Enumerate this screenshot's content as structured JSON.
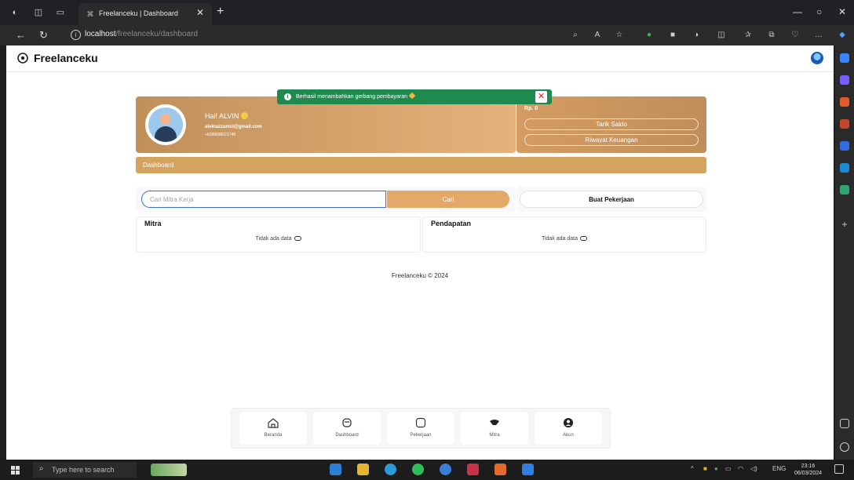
{
  "browser": {
    "tab_title": "Freelanceku | Dashboard",
    "url_host": "localhost",
    "url_path": "/freelanceku/dashboard"
  },
  "header": {
    "brand": "Freelanceku"
  },
  "toast": {
    "message": "Berhasil menambahkan gerbang pembayaran"
  },
  "profile": {
    "greeting": "Hai! ALVIN",
    "email": "alvinazzamul@gmail.com",
    "phone": "+6289686021748"
  },
  "wallet": {
    "balance": "Rp. 0",
    "withdraw_label": "Tarik Saldo",
    "history_label": "Riwayat Keuangan"
  },
  "dashboard_bar": {
    "label": "Dashboard"
  },
  "search": {
    "placeholder": "Cari Mitra Kerja",
    "button_label": "Cari"
  },
  "create_job": {
    "label": "Buat Pekerjaan"
  },
  "panels": {
    "mitra": {
      "title": "Mitra",
      "empty": "Tidak ada data"
    },
    "pendapatan": {
      "title": "Pendapatan",
      "empty": "Tidak ada data"
    }
  },
  "footer": {
    "text": "Freelanceku © 2024"
  },
  "bottom_nav": [
    {
      "label": "Beranda",
      "icon": "home-icon"
    },
    {
      "label": "Dashboard",
      "icon": "dashboard-icon"
    },
    {
      "label": "Pekerjaan",
      "icon": "briefcase-icon"
    },
    {
      "label": "Mitra",
      "icon": "handshake-icon"
    },
    {
      "label": "Akun",
      "icon": "user-icon"
    }
  ],
  "taskbar": {
    "search_text": "Type here to search",
    "language": "ENG",
    "time": "23:16",
    "date": "06/03/2024"
  },
  "colors": {
    "accent_brown": "#d4a35e",
    "toast_green": "#1e8a50",
    "search_button": "#e4a968"
  }
}
